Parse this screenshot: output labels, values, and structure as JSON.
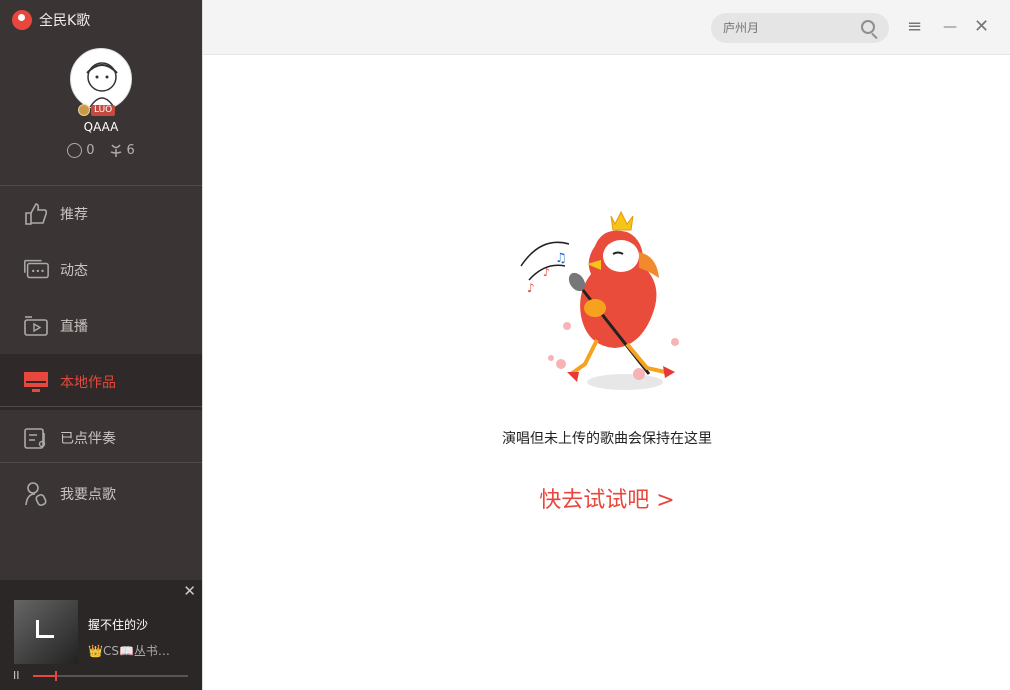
{
  "app": {
    "title": "全民K歌"
  },
  "profile": {
    "username": "QAAA",
    "level_badge": "LUO",
    "stats": [
      {
        "icon": "k-coin-icon",
        "value": "0"
      },
      {
        "icon": "flower-icon",
        "value": "6"
      }
    ]
  },
  "nav": {
    "items": [
      {
        "label": "推荐",
        "icon": "thumbs-up-icon",
        "active": false
      },
      {
        "label": "动态",
        "icon": "chat-bubble-icon",
        "active": false
      },
      {
        "label": "直播",
        "icon": "video-icon",
        "active": false
      },
      {
        "label": "本地作品",
        "icon": "monitor-icon",
        "active": true
      },
      {
        "label": "已点伴奏",
        "icon": "music-list-icon",
        "active": false
      },
      {
        "label": "我要点歌",
        "icon": "user-mic-icon",
        "active": false
      }
    ]
  },
  "player": {
    "song_title": "握不住的沙",
    "artist": "👑CS📖丛书…",
    "close_label": "✕",
    "pause_label": "II",
    "progress": 0.14
  },
  "search": {
    "placeholder": "庐州月"
  },
  "window": {
    "menu_label": "≡",
    "minimize_label": "—",
    "close_label": "✕"
  },
  "main": {
    "empty_message": "演唱但未上传的歌曲会保持在这里",
    "cta_label": "快去试试吧 >"
  },
  "colors": {
    "accent": "#e8473d",
    "sidebar": "#3a3534",
    "sidebar_dark": "#2b2727"
  }
}
